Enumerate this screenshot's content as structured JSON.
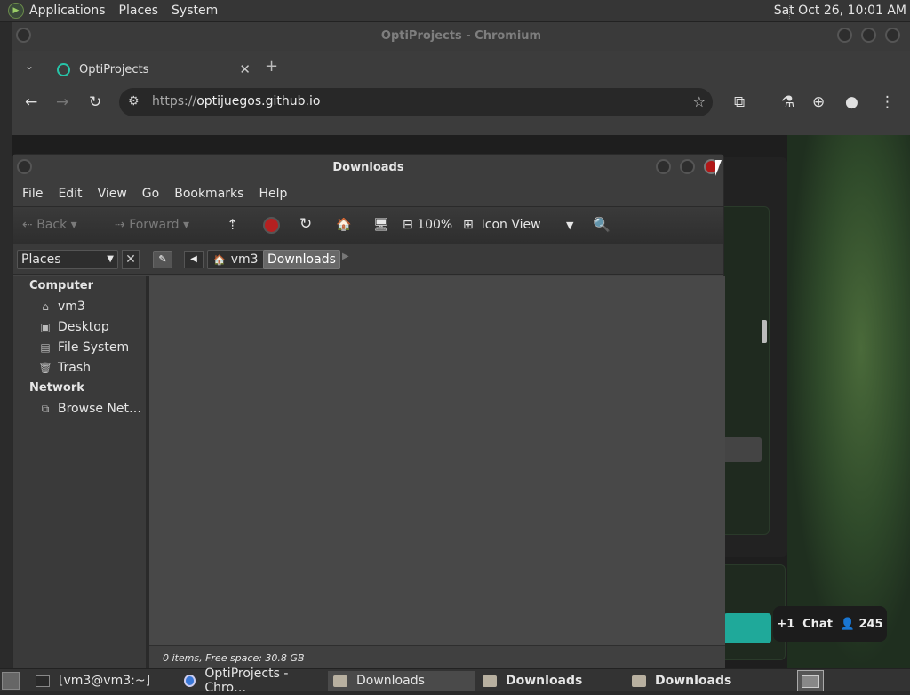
{
  "top_panel": {
    "menus": [
      "Applications",
      "Places",
      "System"
    ],
    "clock": "Sat Oct 26, 10:01 AM"
  },
  "chromium": {
    "window_title": "OptiProjects - Chromium",
    "tab_label": "OptiProjects",
    "url_scheme": "https://",
    "url_host": "optijuegos.github.io",
    "chat_plus": "+1",
    "chat_label": "Chat",
    "chat_count": "245"
  },
  "files": {
    "window_title": "Downloads",
    "menus": [
      "File",
      "Edit",
      "View",
      "Go",
      "Bookmarks",
      "Help"
    ],
    "toolbar": {
      "back": "Back",
      "forward": "Forward",
      "zoom": "100%",
      "view_mode": "Icon View"
    },
    "places_select": "Places",
    "breadcrumb": [
      "vm3",
      "Downloads"
    ],
    "sidebar": {
      "computer_heading": "Computer",
      "computer_items": [
        "vm3",
        "Desktop",
        "File System",
        "Trash"
      ],
      "network_heading": "Network",
      "network_items": [
        "Browse Net…"
      ]
    },
    "status": "0 items, Free space: 30.8 GB"
  },
  "taskbar": {
    "tasks": [
      "[vm3@vm3:~]",
      "OptiProjects - Chro…",
      "Downloads",
      "Downloads",
      "Downloads"
    ]
  }
}
